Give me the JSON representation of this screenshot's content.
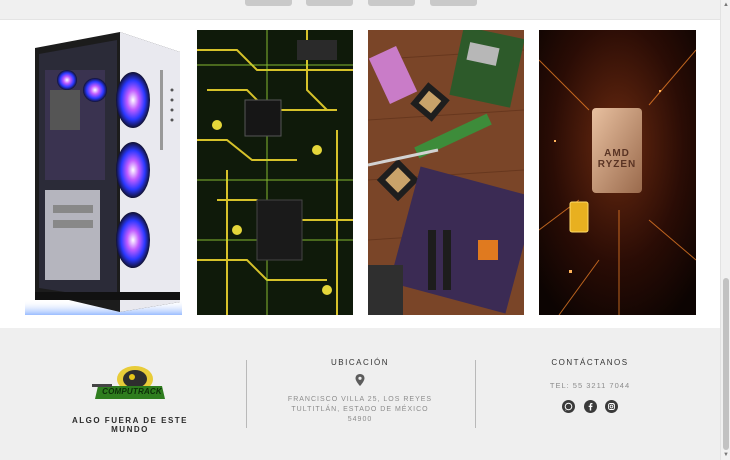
{
  "footer": {
    "logo_text": "COMPUTRACK",
    "tagline": "ALGO FUERA DE ESTE MUNDO",
    "location": {
      "heading": "UBICACIÓN",
      "address_line1": "FRANCISCO VILLA 25, LOS REYES",
      "address_line2": "TULTITLÁN, ESTADO DE MÉXICO 54900"
    },
    "contact": {
      "heading": "CONTÁCTANOS",
      "phone": "TEL: 55 3211 7044",
      "social_icons": [
        "whatsapp-icon",
        "facebook-icon",
        "instagram-icon"
      ]
    }
  },
  "gallery": {
    "cpu_chip_text": "AMD RYZEN"
  },
  "colors": {
    "footer_bg": "#efefef",
    "page_bg": "#ffffff",
    "text_dark": "#2b2b2b",
    "text_muted": "#8c8c8c",
    "logo_green": "#2e7d1e",
    "logo_yellow": "#e6c619"
  }
}
